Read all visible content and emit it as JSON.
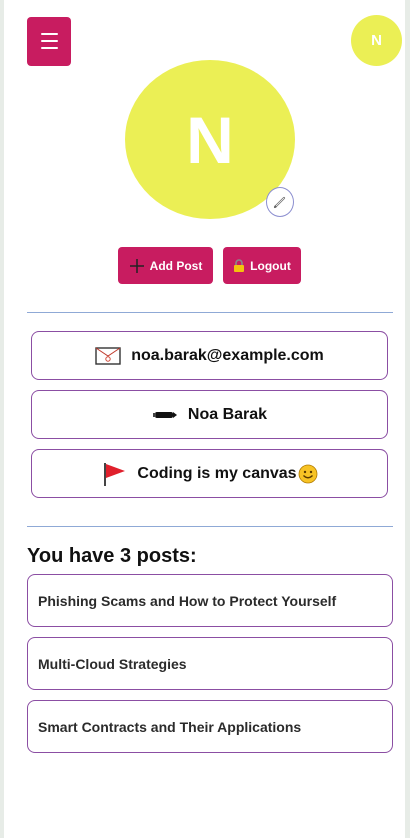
{
  "header": {
    "menu_icon": "hamburger-menu-icon",
    "avatar_initial": "N"
  },
  "profile": {
    "avatar_initial": "N",
    "edit_icon": "pencil-icon"
  },
  "actions": {
    "add_post_label": "Add Post",
    "add_post_icon": "plus-icon",
    "logout_label": "Logout",
    "logout_icon": "lock-icon"
  },
  "info": {
    "email": "noa.barak@example.com",
    "email_icon": "envelope-icon",
    "name": "Noa Barak",
    "name_icon": "pen-icon",
    "bio": "Coding is my canvas",
    "bio_icon": "red-flag-icon",
    "bio_emoji": "smiley-face-icon"
  },
  "posts": {
    "heading": "You have 3 posts:",
    "items": [
      "Phishing Scams and How to Protect Yourself",
      "Multi-Cloud Strategies",
      "Smart Contracts and Their Applications"
    ]
  },
  "colors": {
    "primary": "#c81c60",
    "avatar": "#ebef55",
    "border": "#8b4ea3",
    "divider": "#8fa9d6"
  }
}
